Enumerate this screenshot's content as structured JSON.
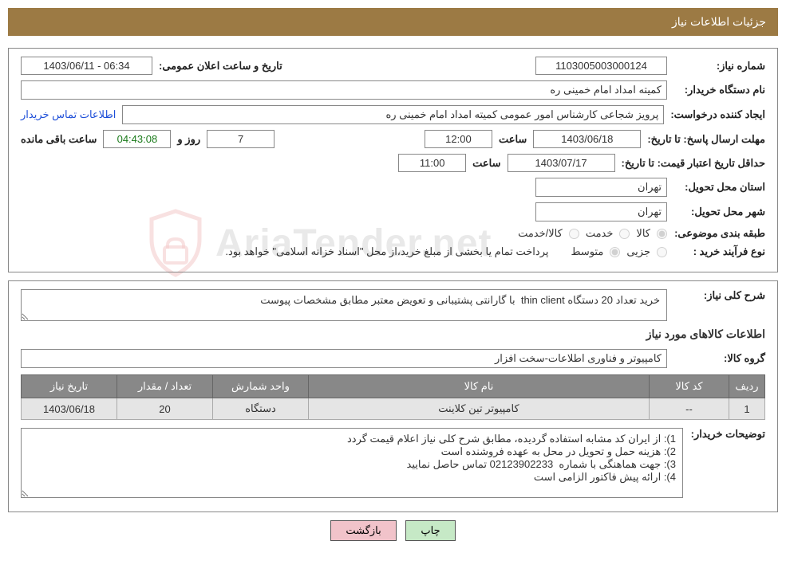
{
  "header": {
    "title": "جزئیات اطلاعات نیاز"
  },
  "section1": {
    "need_number_label": "شماره نیاز:",
    "need_number": "1103005003000124",
    "announce_datetime_label": "تاریخ و ساعت اعلان عمومی:",
    "announce_datetime": "1403/06/11 - 06:34",
    "buyer_org_label": "نام دستگاه خریدار:",
    "buyer_org": "کمیته امداد امام خمینی ره",
    "requester_label": "ایجاد کننده درخواست:",
    "requester": "پرویز شجاعی کارشناس امور عمومی کمیته امداد امام خمینی ره",
    "buyer_contact_link": "اطلاعات تماس خریدار",
    "deadline_label": "مهلت ارسال پاسخ:",
    "to_date_label": "تا تاریخ:",
    "deadline_date": "1403/06/18",
    "time_label": "ساعت",
    "deadline_time": "12:00",
    "days_label": "روز و",
    "days_remaining": "7",
    "countdown": "04:43:08",
    "remaining_label": "ساعت باقی مانده",
    "validity_label": "حداقل تاریخ اعتبار قیمت:",
    "validity_date": "1403/07/17",
    "validity_time": "11:00",
    "province_label": "استان محل تحویل:",
    "province": "تهران",
    "city_label": "شهر محل تحویل:",
    "city": "تهران",
    "category_label": "طبقه بندی موضوعی:",
    "cat_goods": "کالا",
    "cat_service": "خدمت",
    "cat_goods_service": "کالا/خدمت",
    "purchase_type_label": "نوع فرآیند خرید :",
    "pt_minor": "جزیی",
    "pt_medium": "متوسط",
    "purchase_note": "پرداخت تمام یا بخشی از مبلغ خرید،از محل \"اسناد خزانه اسلامی\" خواهد بود."
  },
  "section2": {
    "desc_label": "شرح کلی نیاز:",
    "desc": "خرید تعداد 20 دستگاه thin client  با گارانتی پشتیبانی و تعویض معتبر مطابق مشخصات پیوست",
    "items_title": "اطلاعات کالاهای مورد نیاز",
    "group_label": "گروه کالا:",
    "group": "کامپیوتر و فناوری اطلاعات-سخت افزار",
    "table": {
      "headers": {
        "row": "ردیف",
        "code": "کد کالا",
        "name": "نام کالا",
        "unit": "واحد شمارش",
        "qty": "تعداد / مقدار",
        "date": "تاریخ نیاز"
      },
      "rows": [
        {
          "row": "1",
          "code": "--",
          "name": "کامپیوتر تین کلاینت",
          "unit": "دستگاه",
          "qty": "20",
          "date": "1403/06/18"
        }
      ]
    },
    "buyer_notes_label": "توضیحات خریدار:",
    "buyer_notes": "1): از ایران کد مشابه استفاده گردیده، مطابق شرح کلی نیاز اعلام قیمت گردد\n2): هزینه حمل و تحویل در محل به عهده فروشنده است\n3): جهت هماهنگی با شماره  02123902233 تماس حاصل نمایید\n4): ارائه پیش فاکتور الزامی است"
  },
  "buttons": {
    "print": "چاپ",
    "back": "بازگشت"
  },
  "watermark": "AriaTender.net"
}
